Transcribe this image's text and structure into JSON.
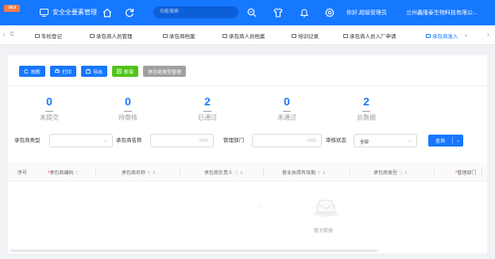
{
  "app": {
    "version_badge": "V8.0",
    "system_name": "安全全要素管理",
    "search_placeholder": "功能搜索",
    "greeting": "你好,超级管理员",
    "company": "兰州鑫隆泰生物科技有限公..."
  },
  "tabs": {
    "prev_arrow": "‹",
    "next_arrow": "›",
    "refresh_icon": "C",
    "items": [
      {
        "label": "车检登记"
      },
      {
        "label": "承包商人员管理"
      },
      {
        "label": "承包商档案"
      },
      {
        "label": "承包商人员档案"
      },
      {
        "label": "培训记录"
      },
      {
        "label": "承包商人员入厂申请"
      },
      {
        "label": "承包商准入",
        "close": "×"
      }
    ]
  },
  "toolbar": {
    "refresh": "刷新",
    "print": "打印",
    "export": "导出",
    "add": "新增",
    "type_manage": "承包商类型管理"
  },
  "stats": [
    {
      "value": "0",
      "label": "未提交"
    },
    {
      "value": "0",
      "label": "待审核"
    },
    {
      "value": "2",
      "label": "已通过"
    },
    {
      "value": "0",
      "label": "未通过"
    },
    {
      "value": "2",
      "label": "总数据"
    }
  ],
  "filters": {
    "type_label": "承包商类型",
    "name_label": "承包商名称",
    "name_count": "0/60",
    "dept_label": "管理部门",
    "dept_count": "0/60",
    "status_label": "审核状态",
    "status_value": "全部",
    "query_button": "查询"
  },
  "table": {
    "columns": [
      {
        "label": "序号",
        "required": false
      },
      {
        "label": "承包商编码",
        "required": true
      },
      {
        "label": "承包商名称",
        "required": false
      },
      {
        "label": "承包商负责人",
        "required": false
      },
      {
        "label": "营业执照有效期",
        "required": false
      },
      {
        "label": "承包商类型",
        "required": false
      },
      {
        "label": "管理部门",
        "required": true
      }
    ],
    "required_mark": "*",
    "empty_text": "暂无数据"
  },
  "colors": {
    "primary": "#1677ff",
    "success": "#52c41a",
    "badge": "#ff7a45",
    "muted_button": "#a0a0a0"
  }
}
